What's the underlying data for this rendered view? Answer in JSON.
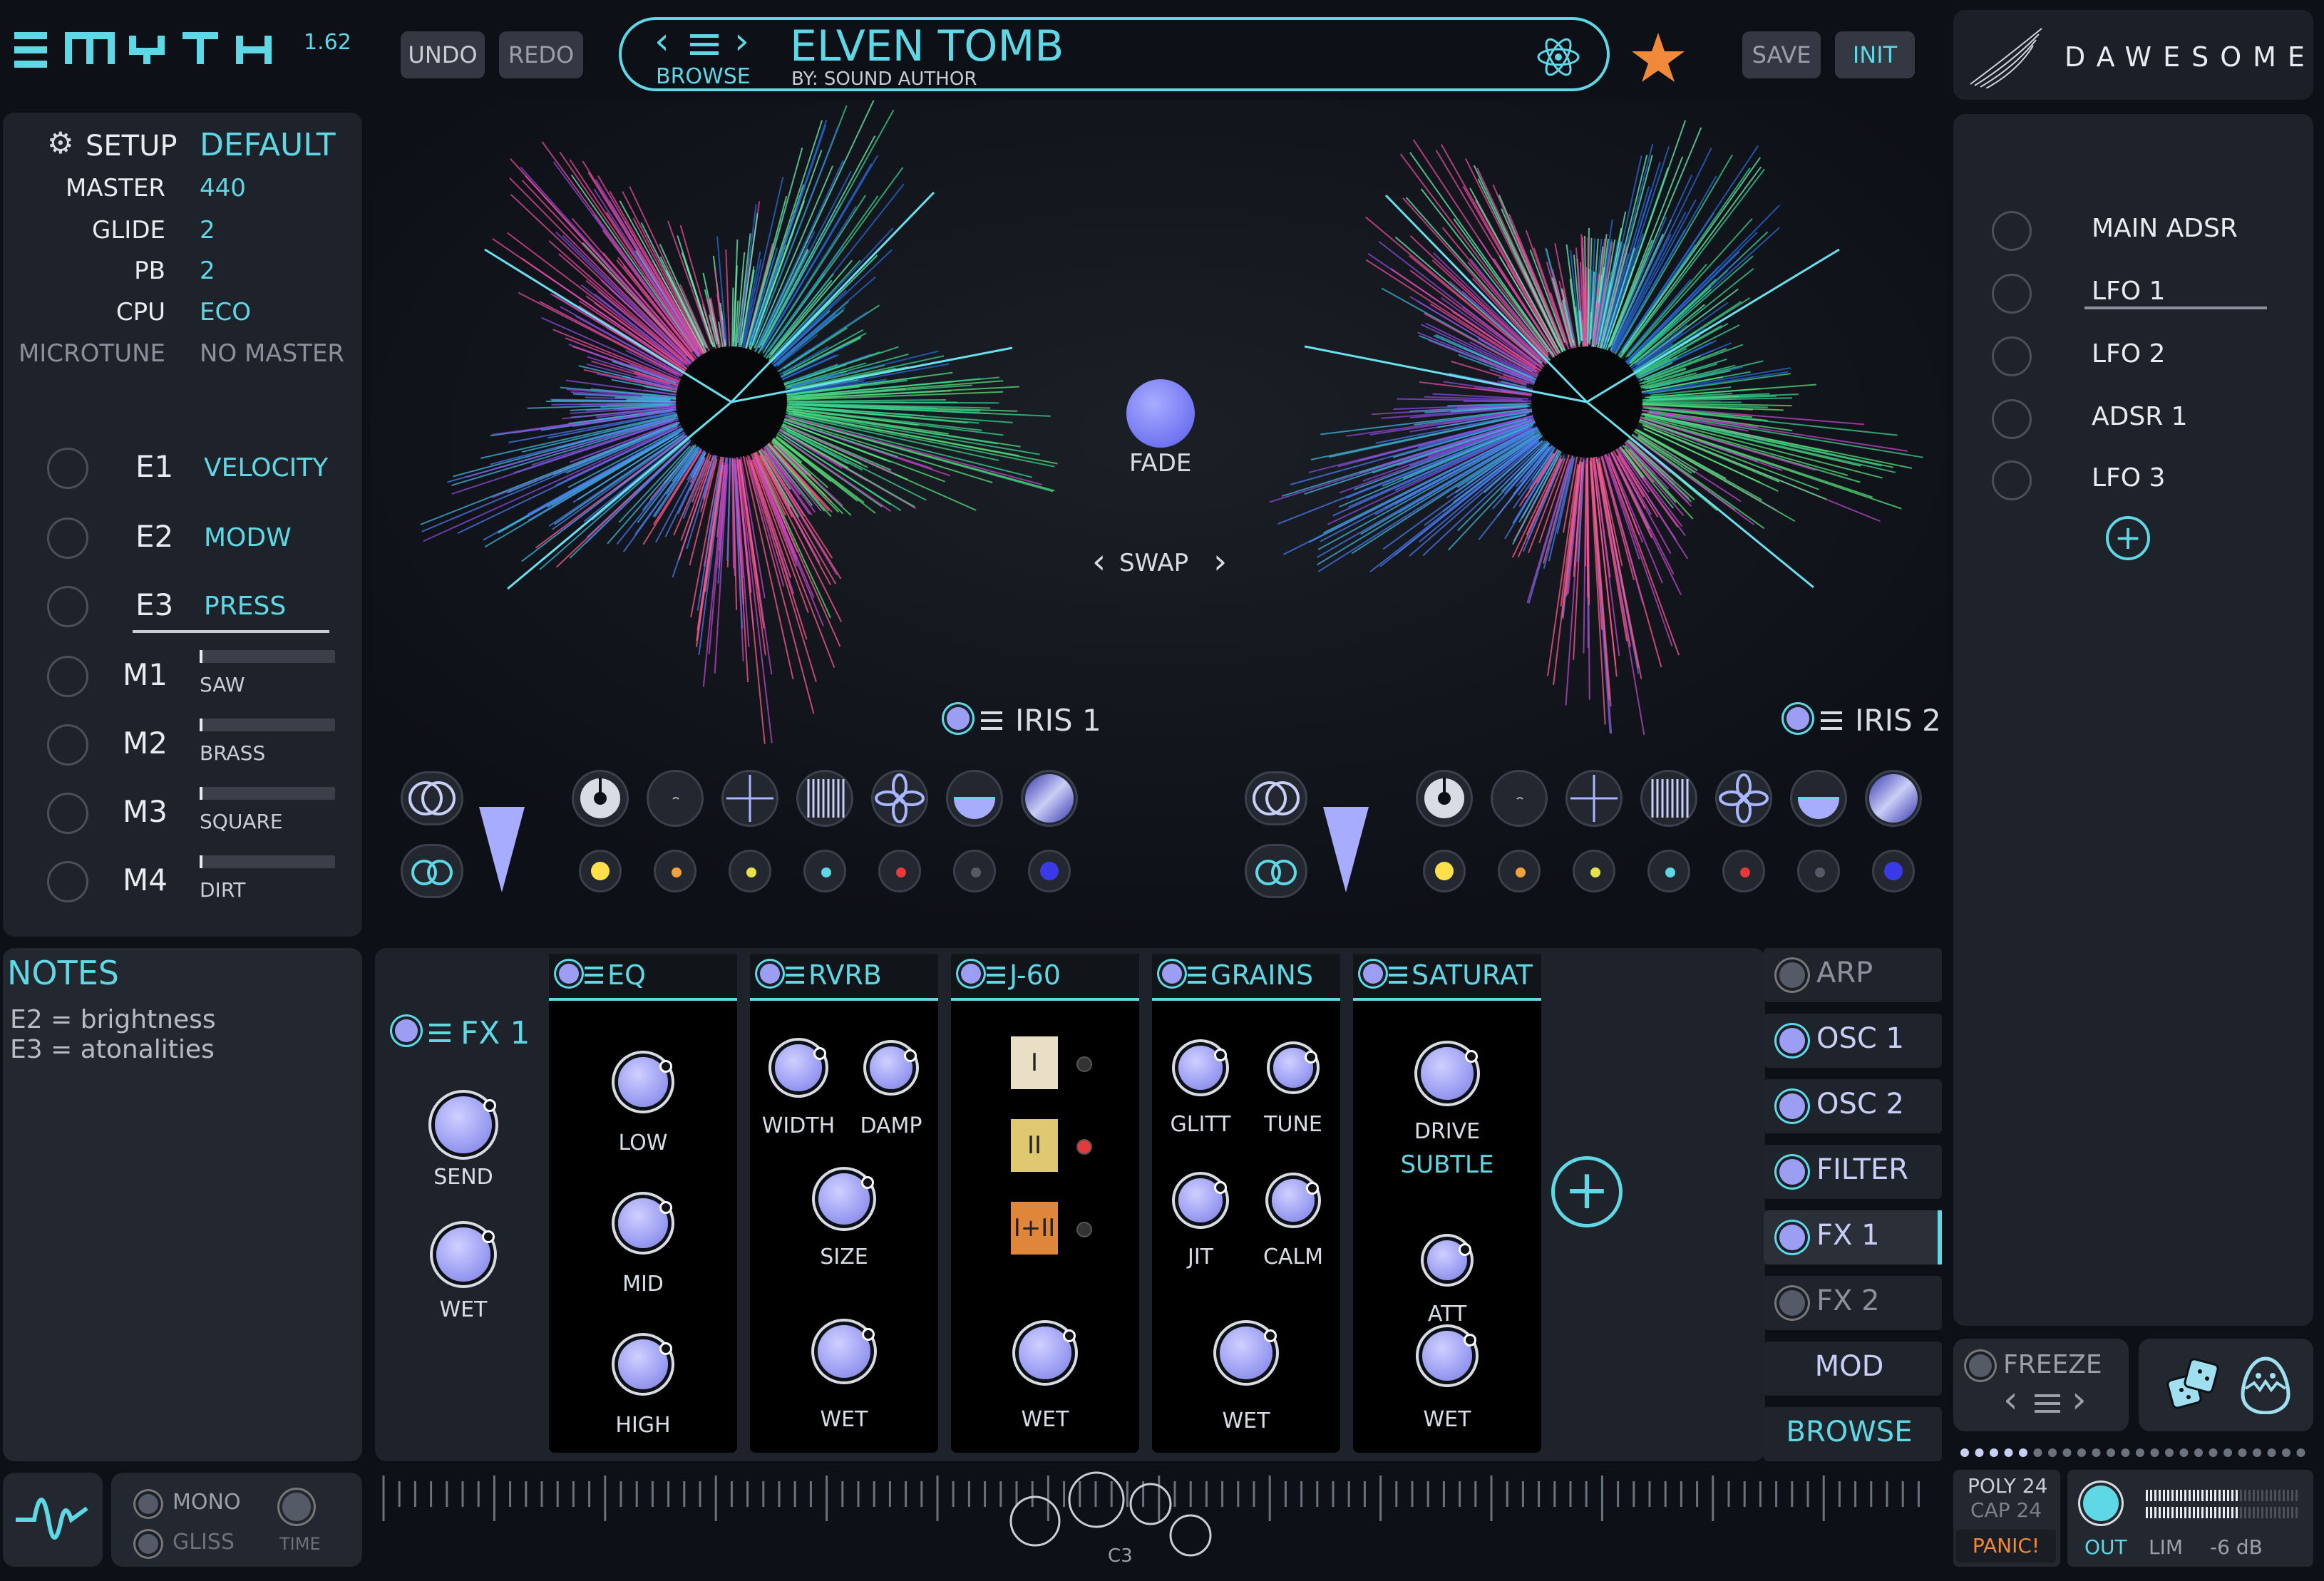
{
  "app": {
    "logo": "MYTH",
    "version": "1.62",
    "brand": "DAWESOME"
  },
  "toolbar": {
    "undo": "UNDO",
    "redo": "REDO",
    "save": "SAVE",
    "init": "INIT",
    "browse": "BROWSE"
  },
  "preset": {
    "name": "ELVEN TOMB",
    "author": "BY: SOUND AUTHOR",
    "favorite": true
  },
  "setup": {
    "title": "SETUP",
    "preset_value": "DEFAULT",
    "rows": [
      {
        "label": "MASTER",
        "value": "440"
      },
      {
        "label": "GLIDE",
        "value": "2"
      },
      {
        "label": "PB",
        "value": "2"
      },
      {
        "label": "CPU",
        "value": "ECO"
      },
      {
        "label": "MICROTUNE",
        "value": "NO MASTER"
      }
    ]
  },
  "macros": [
    {
      "id": "E1",
      "source": "VELOCITY"
    },
    {
      "id": "E2",
      "source": "MODW"
    },
    {
      "id": "E3",
      "source": "PRESS"
    },
    {
      "id": "M1",
      "name": "SAW",
      "level": 0.02
    },
    {
      "id": "M2",
      "name": "BRASS",
      "level": 0.02
    },
    {
      "id": "M3",
      "name": "SQUARE",
      "level": 0.02
    },
    {
      "id": "M4",
      "name": "DIRT",
      "level": 0.02
    }
  ],
  "notes": {
    "title": "NOTES",
    "lines": [
      "E2 = brightness",
      "E3 = atonalities"
    ]
  },
  "center": {
    "fade_label": "FADE",
    "swap_label": "SWAP",
    "iris1": "IRIS 1",
    "iris2": "IRIS 2"
  },
  "modulators": [
    "MAIN ADSR",
    "LFO 1",
    "LFO 2",
    "ADSR 1",
    "LFO 3"
  ],
  "fx": {
    "title": "FX 1",
    "send": "SEND",
    "wet": "WET",
    "units": [
      {
        "title": "EQ",
        "knobs": [
          "LOW",
          "MID",
          "HIGH"
        ]
      },
      {
        "title": "RVRB",
        "knobs": [
          "WIDTH",
          "DAMP",
          "SIZE",
          "WET"
        ]
      },
      {
        "title": "J-60",
        "buttons": [
          "I",
          "II",
          "I+II"
        ],
        "knobs": [
          "WET"
        ]
      },
      {
        "title": "GRAINS",
        "knobs": [
          "GLITT",
          "TUNE",
          "JIT",
          "CALM",
          "WET"
        ]
      },
      {
        "title": "SATURAT",
        "knobs": [
          "DRIVE",
          "ATT",
          "WET"
        ],
        "mode": "SUBTLE"
      }
    ]
  },
  "sections": [
    "ARP",
    "OSC 1",
    "OSC 2",
    "FILTER",
    "FX 1",
    "FX 2",
    "MOD",
    "BROWSE"
  ],
  "freeze": {
    "label": "FREEZE"
  },
  "bottom": {
    "mono": "MONO",
    "gliss": "GLISS",
    "time": "TIME",
    "note": "C3",
    "poly": "POLY 24",
    "cap": "CAP 24",
    "panic": "PANIC!",
    "out": "OUT",
    "lim": "LIM",
    "level": "-6 dB"
  },
  "colors": {
    "accent": "#5fd8e6",
    "knob": "#9c9ef3",
    "star": "#f08a3a"
  }
}
